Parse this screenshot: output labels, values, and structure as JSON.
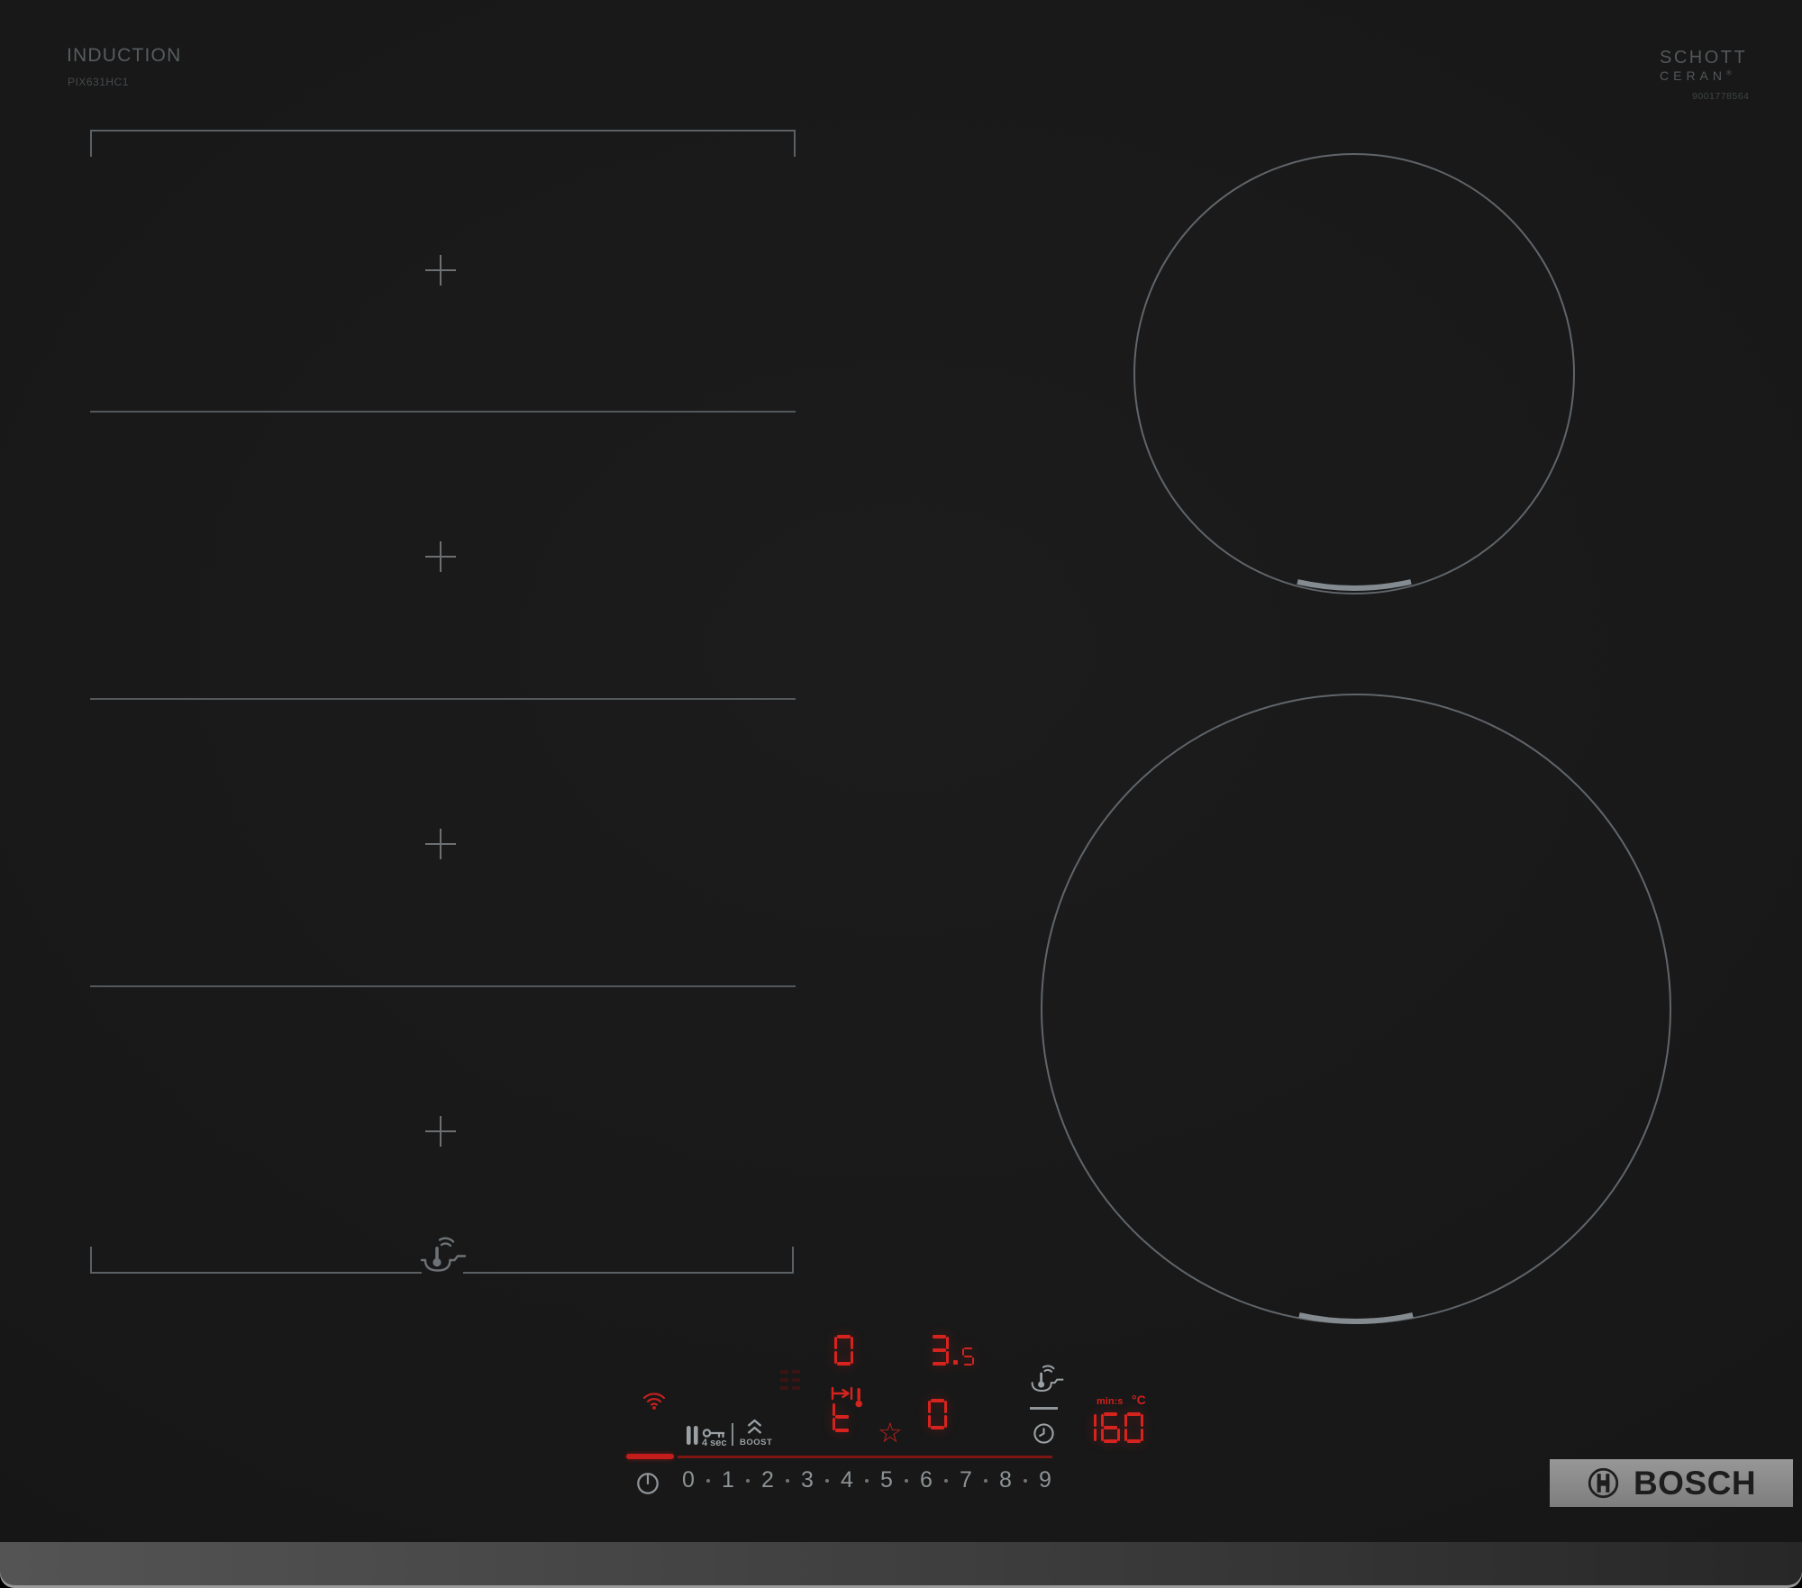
{
  "header": {
    "type_label": "INDUCTION",
    "model": "PIX631HC1"
  },
  "glass_brand": {
    "line1": "SCHOTT",
    "line2": "CERAN",
    "registered": "®",
    "serial": "9001778564"
  },
  "bosch": {
    "logo_text": "BOSCH"
  },
  "controls": {
    "key_hold_label": "4 sec",
    "boost_label": "BOOST",
    "timer_unit_label": "min:s",
    "temp_unit_label": "°C",
    "power_levels": [
      "0",
      "1",
      "2",
      "3",
      "4",
      "5",
      "6",
      "7",
      "8",
      "9"
    ],
    "displays": {
      "flex_zone_level": "0",
      "right_zone_level": "3.5",
      "temp_mode": "t",
      "bottom_zone_level": "0",
      "timer": "160"
    }
  },
  "colors": {
    "led_red": "#d6231e",
    "zone_line_gray": "#5b6064",
    "control_gray": "#9aa0a3"
  }
}
